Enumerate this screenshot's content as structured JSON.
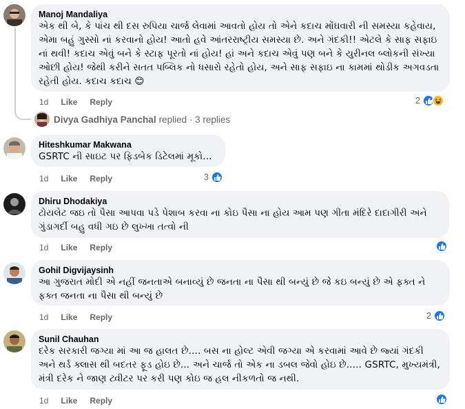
{
  "comments": [
    {
      "author": "Manoj Mandaliya",
      "text": "એક થી બે, કે પાંચ થી દસ રુપિયા ચાર્જ લેવામાં આવતો હોય તો એને કદાચ મોંઘવારી ની સમસ્યા કહેવાય, એમા બહું ગુસ્સો નાં કરવાનો હોય! આતો હવે આંતરરાષ્ટ્રીય સમસ્યા છે. અને ગંદકી!! એટલે કે સાફ સફાઇ નાં થવી! કદાચ એવું બને કે સ્ટાફ પૂરતો નાં હોય! હાં અને કદાચ એવું પણ બને કે યુરીનલ બ્લોકની સંખ્યા ઓછી હોય! જેથી કરીને સતત પબ્લિક નો ધસારો રહેતો હોય, અને સાફ સફાઇ ના કામમાં થોડીક અગવડતા રહેતી હોય. કદાચ કદાચ 😊",
      "time": "1d",
      "like": "Like",
      "reply": "Reply",
      "reaction_count": "2",
      "reactions": [
        "like",
        "haha"
      ],
      "replies_author": "Divya Gadhiya Panchal",
      "replies_text": "replied · 3 replies"
    },
    {
      "author": "Hiteshkumar Makwana",
      "text": "GSRTC ની સાઇટ પર ફિડબેક ડિટેલમાં મૂકો...",
      "time": "1d",
      "like": "Like",
      "reply": "Reply",
      "reaction_count": "3",
      "reactions": [
        "like"
      ]
    },
    {
      "author": "Dhiru Dhodakiya",
      "text": "ટોયલેટ જઇ તો પૈસા આપવા પડે પેશાબ કરવા ના કોઇ પૈસા ના હોય આમ પણ ગીતા મંદિરે દાદાગીરી અને ગુંડાગર્દી બહુ વધી ગઇ છે લુખ્ખા તત્વો ની",
      "time": "1d",
      "like": "Like",
      "reply": "Reply",
      "reaction_count": "",
      "reactions": [
        "like"
      ]
    },
    {
      "author": "Gohil Digvijaysinh",
      "text": "આ ગુજરાત મોદી એ નહીં જનતાએ બનાવ્યું છે જનતા ના પૈસા થી બન્યું છે જે કઇ બન્યું છે એ ફક્ત ને ફક્ત જનતા ના પૈસા થી બન્યું છે",
      "time": "1d",
      "like": "Like",
      "reply": "Reply",
      "reaction_count": "2",
      "reactions": [
        "like"
      ]
    },
    {
      "author": "Sunil Chauhan",
      "text": "દરેક સરકારી જગ્યા માં આ જ હાલત છે.... બસ ના હોલ્ટ એવી જગ્યા એ કરવામાં આવે છે જ્યાં ગંદકી અને થર્ડ ક્લાસ થી બદતર ફૂડ હોઇ છે... અને ચાર્જ તો એક ના ડબલ જેવો હોઇ છે..... GSRTC, મુખ્યમંત્રી, મંત્રી દરેક ને જાણ ટ્વીટર પર કરી પણ કોઇ જ હલ નીકળતો જ નથી.",
      "time": "1d",
      "like": "Like",
      "reply": "Reply",
      "reaction_count": "",
      "reactions": [
        "like"
      ]
    }
  ],
  "colors": {
    "bubble": "#f0f2f5",
    "secondary_text": "#65676b",
    "like_blue": "#1877f2",
    "haha_yellow": "#f7b928"
  }
}
